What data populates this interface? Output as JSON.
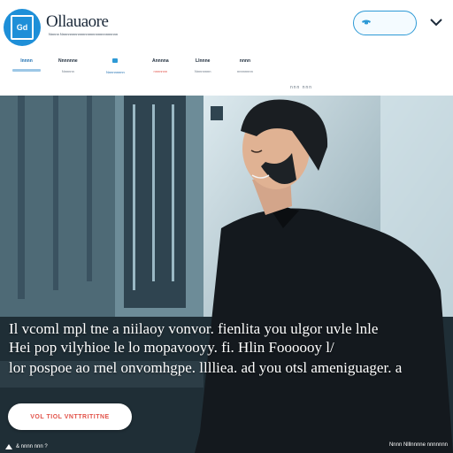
{
  "brand": {
    "badge_text": "Gd",
    "name": "Ollauaore",
    "tagline": "Nnnnn Nnnnnnnnnnnnnnnnnnnnnnnnnnnnn"
  },
  "header": {
    "phone_label": "",
    "menu_icon": "chevron-down-icon"
  },
  "nav": {
    "items": [
      {
        "title": "Innnn",
        "sub": ""
      },
      {
        "title": "Nnnnnne",
        "sub": "Nnnnnn"
      },
      {
        "title": "",
        "sub": "Nnnnnnnnn"
      },
      {
        "title": "Annnna",
        "sub": "nnnnnnn"
      },
      {
        "title": "Llnnne",
        "sub": "Nnnnnnnn"
      },
      {
        "title": "nnnn",
        "sub": "nnnnnnnn"
      }
    ],
    "subnav": "nnn nnn"
  },
  "hero": {
    "line1": "Il vcoml mpl tne a niilaoy vonvor. fienlita you ulgor uvle lnle",
    "line2": "Hei pop vilyhioe le lo mopavooyy. fi. Hlin Foooooy l/",
    "line3": "lor pospoe ao rnel onvomhgpe. lllliea. ad you otsl ameniguager. a",
    "cta_label": "VOL TIOL VNTTRITITNE",
    "footer_left": "& nnnn nnn ?",
    "footer_right": "Nnnn Nlllnnnne  nnnnnnn"
  },
  "colors": {
    "brand_blue": "#1e8fd8",
    "accent_red": "#e2534a",
    "header_bg": "#ffffff"
  }
}
